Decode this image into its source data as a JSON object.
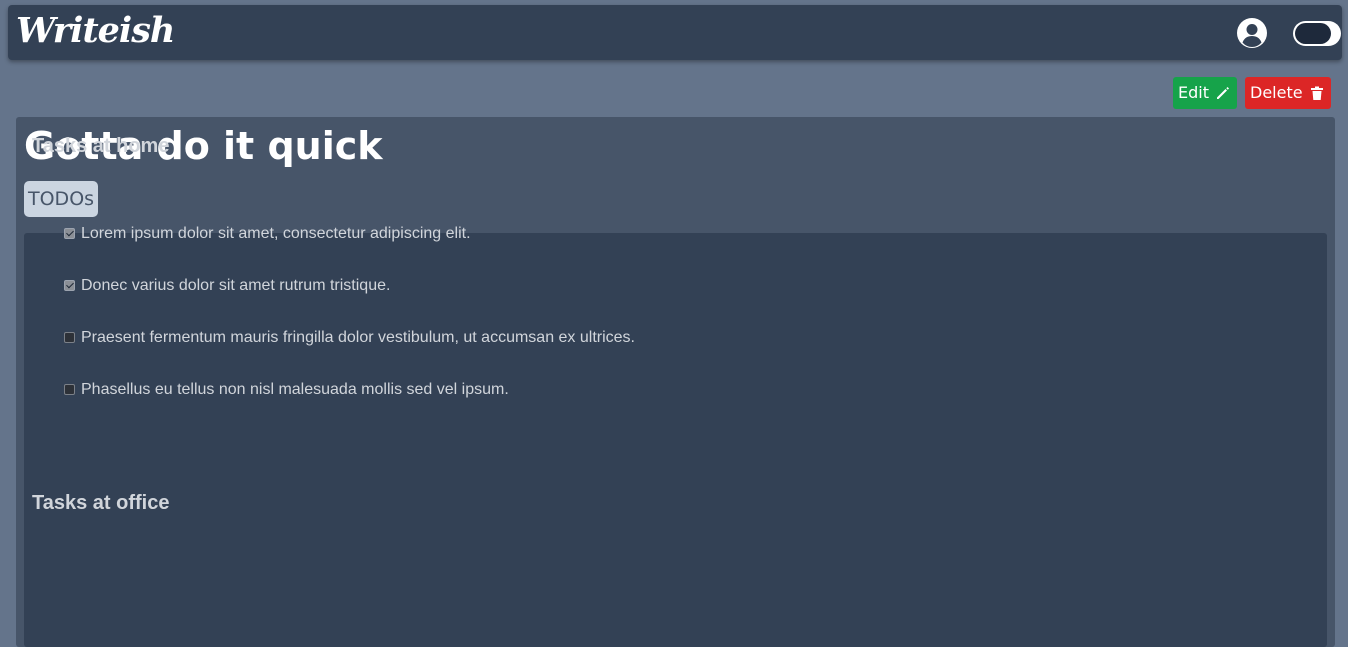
{
  "app": {
    "logo_text": "Writeish"
  },
  "header": {
    "profile_icon": "user-circle-icon",
    "theme_toggle_icon": "dark-mode-toggle"
  },
  "toolbar": {
    "edit_label": "Edit",
    "edit_icon": "pencil-icon",
    "delete_label": "Delete",
    "delete_icon": "trash-icon"
  },
  "note": {
    "title": "Gotta do it quick",
    "tag": "TODOs",
    "sections": [
      {
        "title": "Tasks at home",
        "tasks": [
          {
            "label": "Lorem ipsum dolor sit amet, consectetur adipiscing elit.",
            "checked": true
          },
          {
            "label": "Donec varius dolor sit amet rutrum tristique.",
            "checked": true
          },
          {
            "label": "Praesent fermentum mauris fringilla dolor vestibulum, ut accumsan ex ultrices.",
            "checked": false
          },
          {
            "label": "Phasellus eu tellus non nisl malesuada mollis sed vel ipsum.",
            "checked": false
          }
        ]
      },
      {
        "title": "Tasks at office",
        "tasks": []
      }
    ]
  },
  "colors": {
    "page_background": "#64748b",
    "navbar": "#334155",
    "edit_button": "#16a34a",
    "delete_button": "#dc2626",
    "note_background": "#475569",
    "content_background": "#334155"
  }
}
